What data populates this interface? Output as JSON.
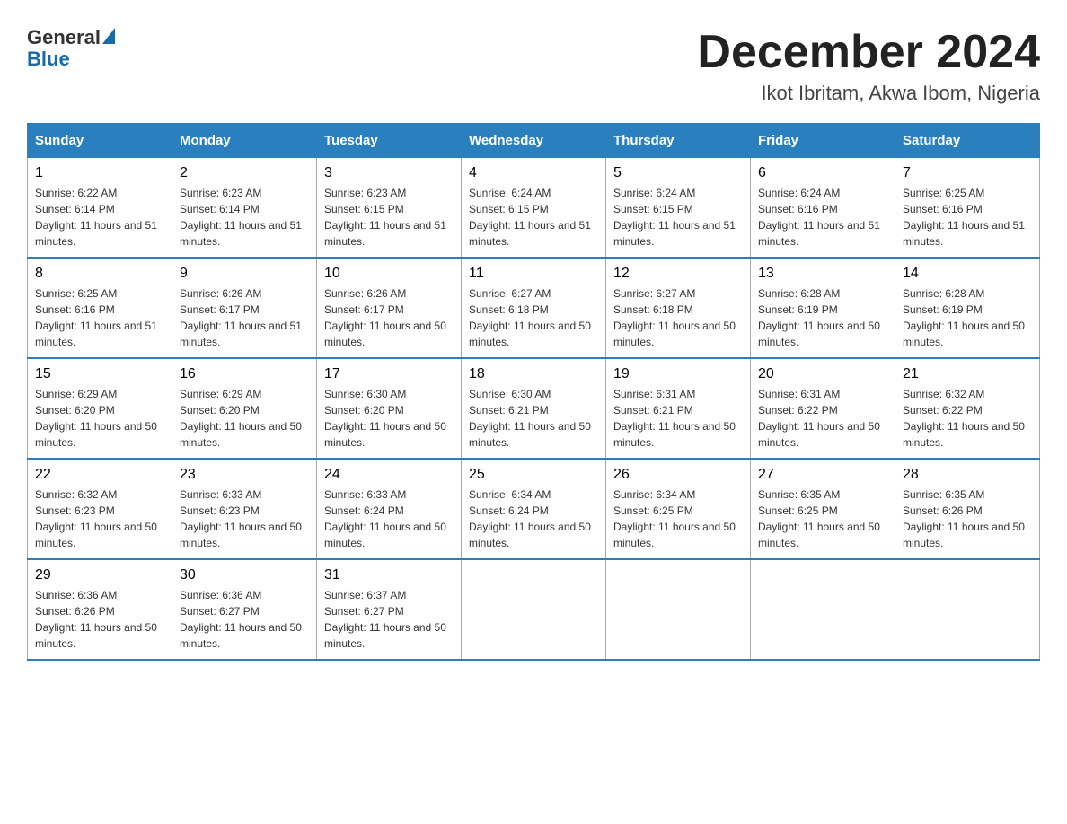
{
  "header": {
    "logo_general": "General",
    "logo_blue": "Blue",
    "month_title": "December 2024",
    "location": "Ikot Ibritam, Akwa Ibom, Nigeria"
  },
  "days_of_week": [
    "Sunday",
    "Monday",
    "Tuesday",
    "Wednesday",
    "Thursday",
    "Friday",
    "Saturday"
  ],
  "weeks": [
    [
      {
        "day": "1",
        "sunrise": "6:22 AM",
        "sunset": "6:14 PM",
        "daylight": "11 hours and 51 minutes."
      },
      {
        "day": "2",
        "sunrise": "6:23 AM",
        "sunset": "6:14 PM",
        "daylight": "11 hours and 51 minutes."
      },
      {
        "day": "3",
        "sunrise": "6:23 AM",
        "sunset": "6:15 PM",
        "daylight": "11 hours and 51 minutes."
      },
      {
        "day": "4",
        "sunrise": "6:24 AM",
        "sunset": "6:15 PM",
        "daylight": "11 hours and 51 minutes."
      },
      {
        "day": "5",
        "sunrise": "6:24 AM",
        "sunset": "6:15 PM",
        "daylight": "11 hours and 51 minutes."
      },
      {
        "day": "6",
        "sunrise": "6:24 AM",
        "sunset": "6:16 PM",
        "daylight": "11 hours and 51 minutes."
      },
      {
        "day": "7",
        "sunrise": "6:25 AM",
        "sunset": "6:16 PM",
        "daylight": "11 hours and 51 minutes."
      }
    ],
    [
      {
        "day": "8",
        "sunrise": "6:25 AM",
        "sunset": "6:16 PM",
        "daylight": "11 hours and 51 minutes."
      },
      {
        "day": "9",
        "sunrise": "6:26 AM",
        "sunset": "6:17 PM",
        "daylight": "11 hours and 51 minutes."
      },
      {
        "day": "10",
        "sunrise": "6:26 AM",
        "sunset": "6:17 PM",
        "daylight": "11 hours and 50 minutes."
      },
      {
        "day": "11",
        "sunrise": "6:27 AM",
        "sunset": "6:18 PM",
        "daylight": "11 hours and 50 minutes."
      },
      {
        "day": "12",
        "sunrise": "6:27 AM",
        "sunset": "6:18 PM",
        "daylight": "11 hours and 50 minutes."
      },
      {
        "day": "13",
        "sunrise": "6:28 AM",
        "sunset": "6:19 PM",
        "daylight": "11 hours and 50 minutes."
      },
      {
        "day": "14",
        "sunrise": "6:28 AM",
        "sunset": "6:19 PM",
        "daylight": "11 hours and 50 minutes."
      }
    ],
    [
      {
        "day": "15",
        "sunrise": "6:29 AM",
        "sunset": "6:20 PM",
        "daylight": "11 hours and 50 minutes."
      },
      {
        "day": "16",
        "sunrise": "6:29 AM",
        "sunset": "6:20 PM",
        "daylight": "11 hours and 50 minutes."
      },
      {
        "day": "17",
        "sunrise": "6:30 AM",
        "sunset": "6:20 PM",
        "daylight": "11 hours and 50 minutes."
      },
      {
        "day": "18",
        "sunrise": "6:30 AM",
        "sunset": "6:21 PM",
        "daylight": "11 hours and 50 minutes."
      },
      {
        "day": "19",
        "sunrise": "6:31 AM",
        "sunset": "6:21 PM",
        "daylight": "11 hours and 50 minutes."
      },
      {
        "day": "20",
        "sunrise": "6:31 AM",
        "sunset": "6:22 PM",
        "daylight": "11 hours and 50 minutes."
      },
      {
        "day": "21",
        "sunrise": "6:32 AM",
        "sunset": "6:22 PM",
        "daylight": "11 hours and 50 minutes."
      }
    ],
    [
      {
        "day": "22",
        "sunrise": "6:32 AM",
        "sunset": "6:23 PM",
        "daylight": "11 hours and 50 minutes."
      },
      {
        "day": "23",
        "sunrise": "6:33 AM",
        "sunset": "6:23 PM",
        "daylight": "11 hours and 50 minutes."
      },
      {
        "day": "24",
        "sunrise": "6:33 AM",
        "sunset": "6:24 PM",
        "daylight": "11 hours and 50 minutes."
      },
      {
        "day": "25",
        "sunrise": "6:34 AM",
        "sunset": "6:24 PM",
        "daylight": "11 hours and 50 minutes."
      },
      {
        "day": "26",
        "sunrise": "6:34 AM",
        "sunset": "6:25 PM",
        "daylight": "11 hours and 50 minutes."
      },
      {
        "day": "27",
        "sunrise": "6:35 AM",
        "sunset": "6:25 PM",
        "daylight": "11 hours and 50 minutes."
      },
      {
        "day": "28",
        "sunrise": "6:35 AM",
        "sunset": "6:26 PM",
        "daylight": "11 hours and 50 minutes."
      }
    ],
    [
      {
        "day": "29",
        "sunrise": "6:36 AM",
        "sunset": "6:26 PM",
        "daylight": "11 hours and 50 minutes."
      },
      {
        "day": "30",
        "sunrise": "6:36 AM",
        "sunset": "6:27 PM",
        "daylight": "11 hours and 50 minutes."
      },
      {
        "day": "31",
        "sunrise": "6:37 AM",
        "sunset": "6:27 PM",
        "daylight": "11 hours and 50 minutes."
      },
      null,
      null,
      null,
      null
    ]
  ]
}
